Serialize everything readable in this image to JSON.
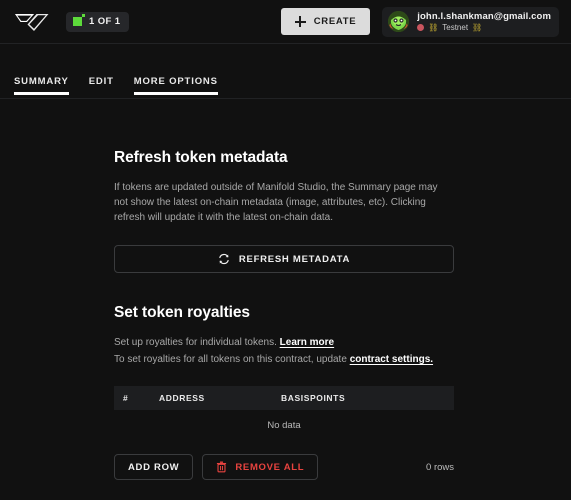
{
  "app": {
    "logo_name": "manifold-logo",
    "background": "#111111"
  },
  "topbar": {
    "token_badge": {
      "icon": "token-square-icon",
      "label": "1 OF 1",
      "icon_color": "#5ddb3b"
    },
    "create_button": {
      "label": "CREATE",
      "icon": "plus-icon",
      "background": "#dcdcdc"
    },
    "account": {
      "avatar_name": "user-avatar",
      "email": "john.l.shankman@gmail.com",
      "network_dot_color": "#c9555e",
      "network_emoji_left": "⛓",
      "network_label": "Testnet",
      "network_emoji_right": "⛓"
    }
  },
  "tabs": [
    {
      "label": "SUMMARY",
      "active": true
    },
    {
      "label": "EDIT",
      "active": false
    },
    {
      "label": "MORE OPTIONS",
      "active": true
    }
  ],
  "main": {
    "refresh_section": {
      "title": "Refresh token metadata",
      "description": "If tokens are updated outside of Manifold Studio, the Summary page may not show the latest on-chain metadata (image, attributes, etc). Clicking refresh will update it with the latest on-chain data.",
      "button_label": "REFRESH METADATA",
      "button_icon": "refresh-icon"
    },
    "royalties_section": {
      "title": "Set token royalties",
      "line1_text": "Set up royalties for individual tokens. ",
      "line1_link": "Learn more",
      "line2_text": "To set royalties for all tokens on this contract, update ",
      "line2_link": "contract settings.",
      "table": {
        "columns": [
          "#",
          "ADDRESS",
          "BASISPOINTS"
        ],
        "rows": [],
        "empty_text": "No data"
      },
      "actions": {
        "add_row_label": "ADD ROW",
        "remove_all_label": "REMOVE ALL",
        "remove_all_icon": "trash-icon",
        "remove_all_color": "#e8433f",
        "rows_count_label": "0 rows"
      }
    }
  }
}
